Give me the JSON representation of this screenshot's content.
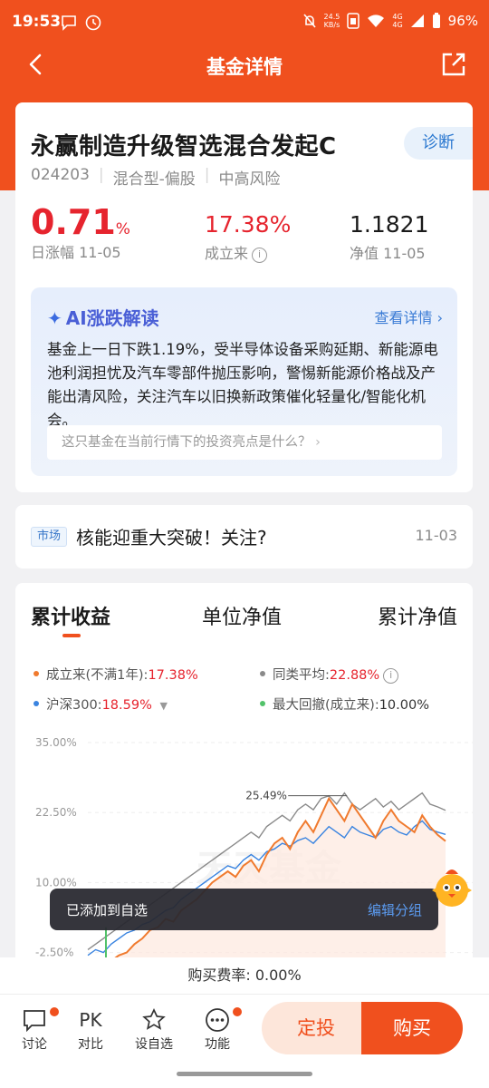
{
  "status": {
    "time": "19:53",
    "net_speed_top": "24.5",
    "net_speed_bottom": "KB/s",
    "sig1": "4G",
    "sig2": "4G",
    "battery": "96%"
  },
  "nav": {
    "title": "基金详情"
  },
  "fund": {
    "name": "永赢制造升级智选混合发起C",
    "diagnose_label": "诊断",
    "code": "024203",
    "type": "混合型-偏股",
    "risk": "中高风险",
    "day_change": "0.71",
    "day_change_unit": "%",
    "day_change_label": "日涨幅 11-05",
    "since_inception": "17.38%",
    "since_inception_label": "成立来",
    "nav_value": "1.1821",
    "nav_label": "净值 11-05"
  },
  "ai": {
    "title": "AI涨跌解读",
    "more": "查看详情",
    "text": "基金上一日下跌1.19%，受半导体设备采购延期、新能源电池利润担忧及汽车零部件抛压影响，警惕新能源价格战及产能出清风险，关注汽车以旧换新政策催化轻量化/智能化机会。",
    "question": "这只基金在当前行情下的投资亮点是什么？"
  },
  "news": {
    "tag": "市场",
    "text": "核能迎重大突破！关注?",
    "date": "11-03"
  },
  "chart_tabs": [
    "累计收益",
    "单位净值",
    "累计净值"
  ],
  "legend": {
    "self_label": "成立来(不满1年):",
    "self_value": "17.38%",
    "peer_label": "同类平均:",
    "peer_value": "22.88%",
    "hs300_label": "沪深300:",
    "hs300_value": "18.59%",
    "mdd_label": "最大回撤(成立来):",
    "mdd_value": "10.00%"
  },
  "chart_data": {
    "type": "line",
    "yticks": [
      "35.00%",
      "22.50%",
      "10.00%",
      "-2.50%"
    ],
    "ylim": [
      -5,
      35
    ],
    "annotation": "25.49%",
    "watermark": "天天基金",
    "series": [
      {
        "name": "成立来(不满1年)",
        "color": "#f07a2e",
        "values": [
          -6,
          -5,
          -5.5,
          -4,
          -3,
          -2.5,
          -1,
          0,
          1.5,
          2,
          3.5,
          3,
          5,
          6,
          7,
          8.5,
          10,
          11,
          12,
          11,
          13,
          14,
          12,
          15,
          17,
          18,
          16,
          19,
          21,
          19,
          22,
          25,
          23,
          21,
          24,
          22,
          20,
          18,
          21,
          23,
          21,
          20,
          19,
          22,
          20,
          18.5,
          17.4
        ]
      },
      {
        "name": "沪深300",
        "color": "#3a84e0",
        "values": [
          -3,
          -2,
          -2.5,
          -1,
          0,
          1,
          1.5,
          2.5,
          3,
          4,
          5,
          5.5,
          7,
          8,
          9,
          10,
          11,
          12,
          13,
          12.5,
          14,
          15,
          14,
          15.5,
          16,
          17,
          16.5,
          17.5,
          18,
          17,
          18.5,
          20,
          19,
          18,
          20,
          19,
          18.5,
          18,
          19.5,
          20,
          19,
          18.5,
          20,
          21,
          19.5,
          19,
          18.6
        ]
      },
      {
        "name": "同类平均",
        "color": "#8a8a8a",
        "values": [
          -2,
          -1,
          0,
          1,
          2,
          3,
          4,
          5,
          6,
          7,
          8,
          9,
          10,
          11,
          12,
          13,
          14,
          15,
          16,
          17,
          18,
          19,
          18,
          20,
          21,
          22,
          21,
          23,
          24,
          23,
          25,
          25.5,
          24,
          26,
          24,
          23,
          24,
          25,
          23.5,
          24.5,
          23,
          24,
          25,
          26,
          24,
          23.5,
          22.9
        ]
      }
    ]
  },
  "toast": {
    "message": "已添加到自选",
    "action": "编辑分组"
  },
  "fee": {
    "label": "购买费率:",
    "value": "0.00%"
  },
  "bottom": {
    "items": [
      "讨论",
      "对比",
      "设自选",
      "功能"
    ],
    "pk_text": "PK",
    "fixed_invest": "定投",
    "buy": "购买"
  }
}
